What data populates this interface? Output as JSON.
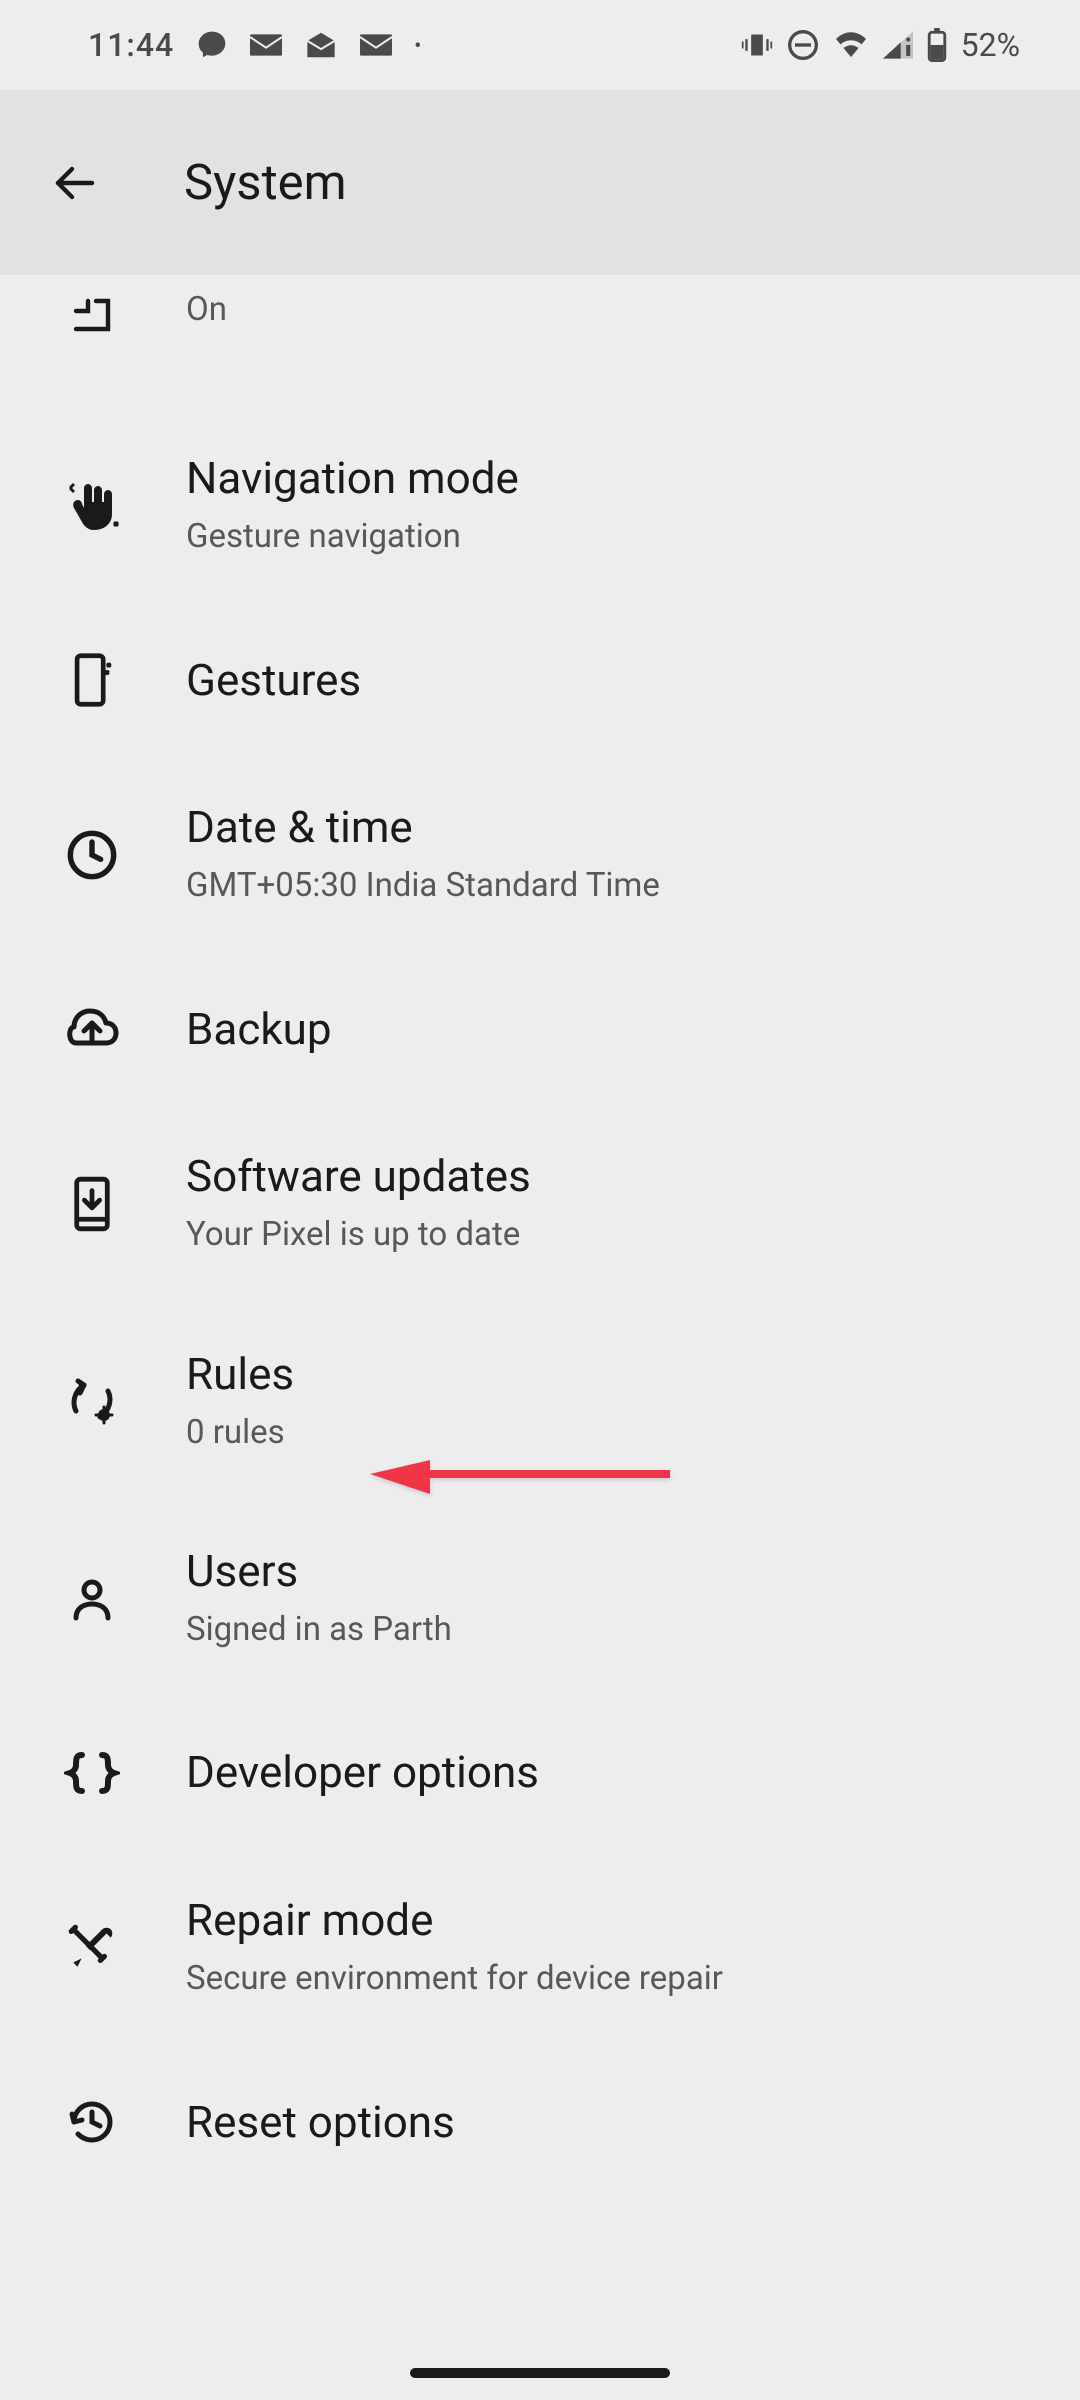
{
  "status_bar": {
    "time": "11:44",
    "battery_percent": "52%"
  },
  "app_bar": {
    "title": "System"
  },
  "partial_item": {
    "subtitle": "On"
  },
  "items": [
    {
      "title": "Navigation mode",
      "subtitle": "Gesture navigation",
      "icon": "hand-icon"
    },
    {
      "title": "Gestures",
      "subtitle": "",
      "icon": "phone-sparkle-icon"
    },
    {
      "title": "Date & time",
      "subtitle": "GMT+05:30 India Standard Time",
      "icon": "clock-icon"
    },
    {
      "title": "Backup",
      "subtitle": "",
      "icon": "cloud-upload-icon"
    },
    {
      "title": "Software updates",
      "subtitle": "Your Pixel is up to date",
      "icon": "phone-download-icon"
    },
    {
      "title": "Rules",
      "subtitle": "0 rules",
      "icon": "automation-icon"
    },
    {
      "title": "Users",
      "subtitle": "Signed in as Parth",
      "icon": "user-icon"
    },
    {
      "title": "Developer options",
      "subtitle": "",
      "icon": "braces-icon"
    },
    {
      "title": "Repair mode",
      "subtitle": "Secure environment for device repair",
      "icon": "tools-icon"
    },
    {
      "title": "Reset options",
      "subtitle": "",
      "icon": "history-icon"
    }
  ],
  "annotation": {
    "target": "Rules",
    "color": "#f0354a"
  }
}
